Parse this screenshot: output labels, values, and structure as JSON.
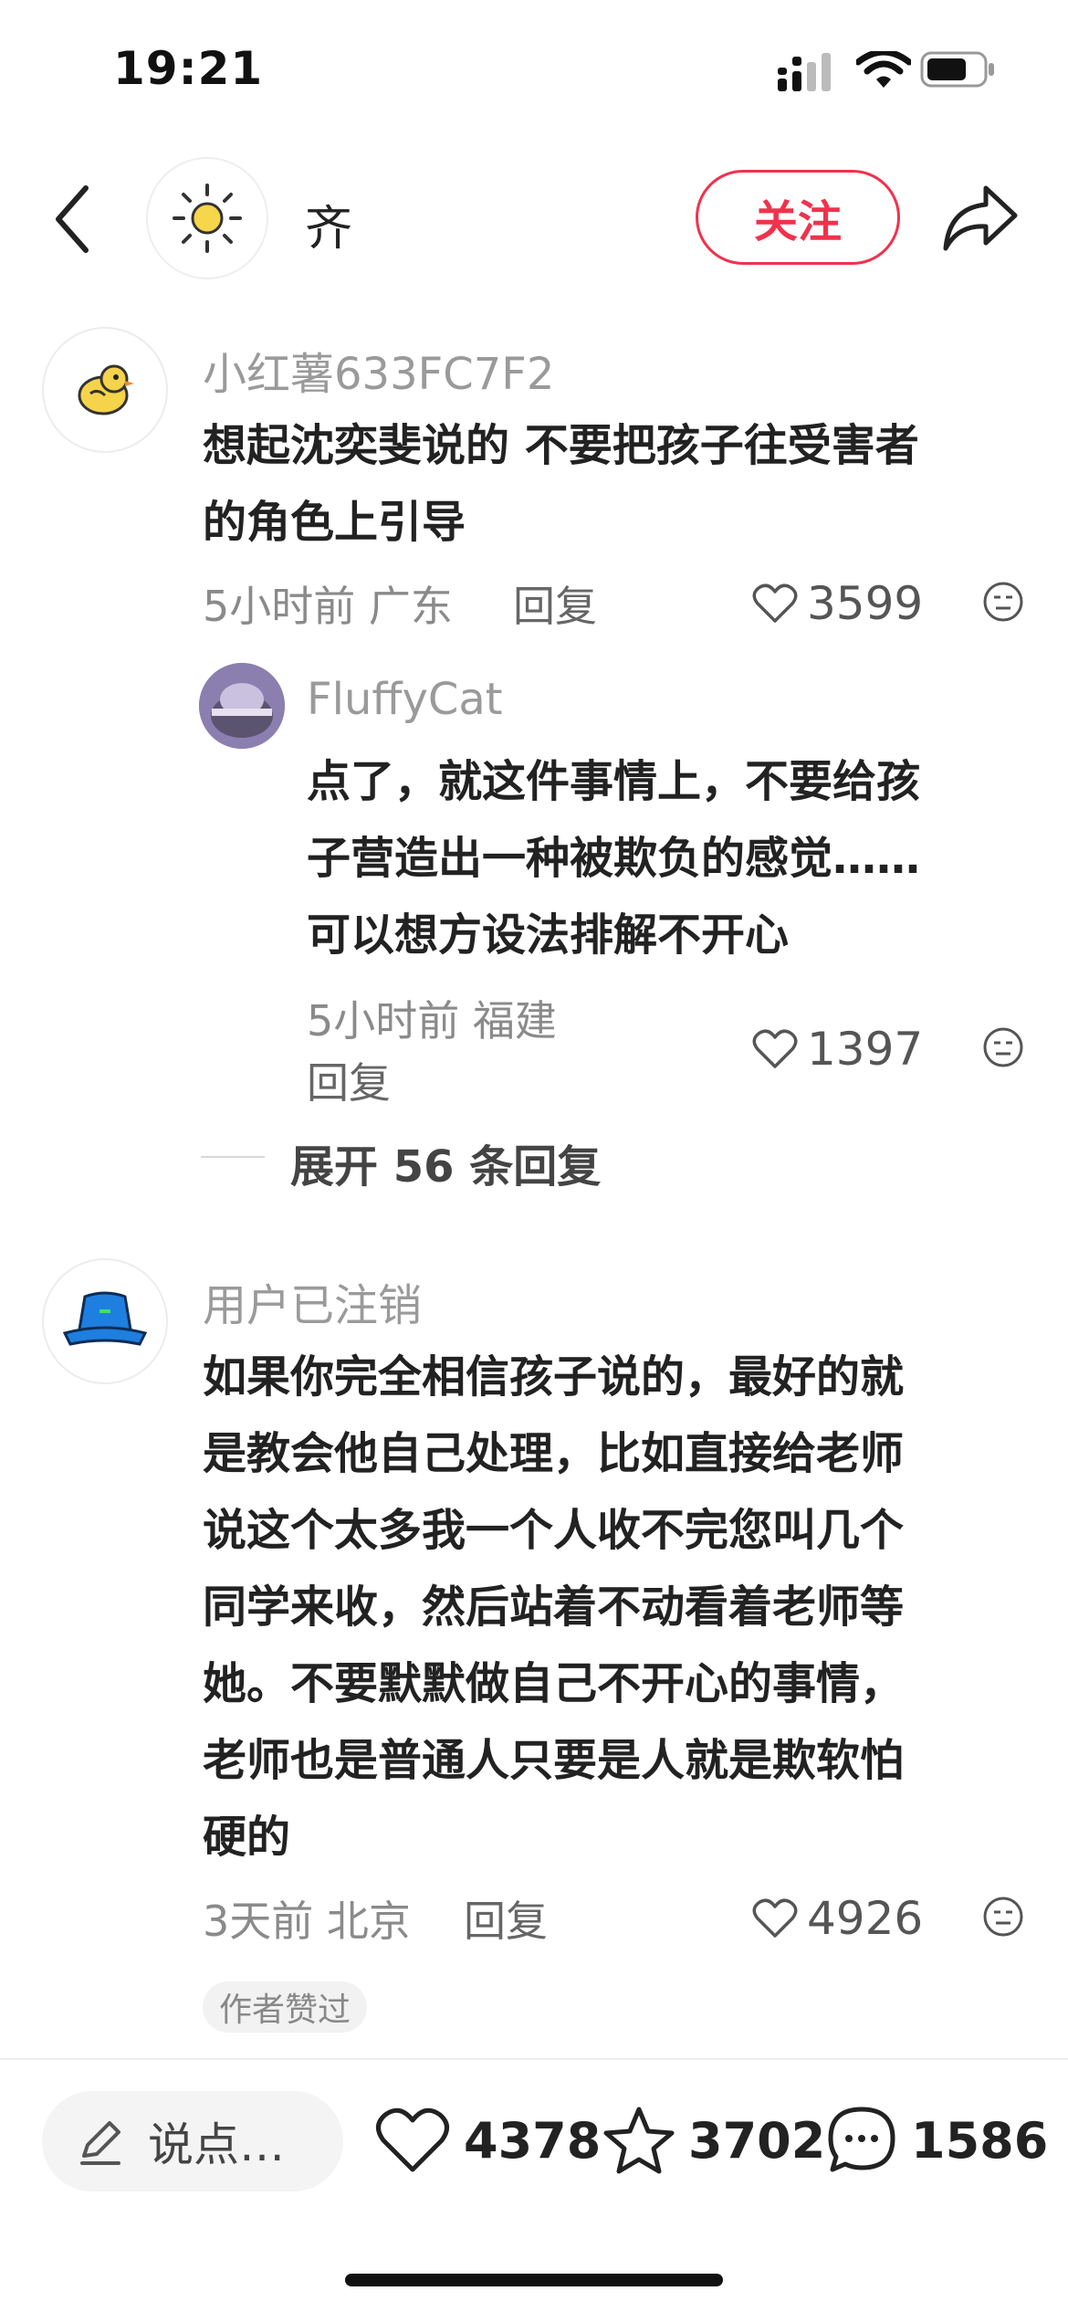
{
  "status_bar": {
    "time": "19:21"
  },
  "header": {
    "name": "齐",
    "follow_label": "关注"
  },
  "comments": [
    {
      "user": "小红薯633FC7F2",
      "lines": [
        "想起沈奕斐说的 不要把孩子往受害者",
        "的角色上引导"
      ],
      "meta": "5小时前 广东",
      "reply_label": "回复",
      "likes": "3599"
    },
    {
      "user": "FluffyCat",
      "lines": [
        "点了，就这件事情上，不要给孩",
        "子营造出一种被欺负的感觉……",
        "可以想方设法排解不开心"
      ],
      "meta": "5小时前 福建",
      "reply_label": "回复",
      "likes": "1397"
    },
    {
      "user": "用户已注销",
      "lines": [
        "如果你完全相信孩子说的，最好的就",
        "是教会他自己处理，比如直接给老师",
        "说这个太多我一个人收不完您叫几个",
        "同学来收，然后站着不动看着老师等",
        "她。不要默默做自己不开心的事情，",
        "老师也是普通人只要是人就是欺软怕",
        "硬的"
      ],
      "meta": "3天前 北京",
      "reply_label": "回复",
      "likes": "4926",
      "tag": "作者赞过"
    }
  ],
  "expand_replies": "展开 56 条回复",
  "bottom_bar": {
    "input_placeholder": "说点…",
    "likes": "4378",
    "stars": "3702",
    "comments": "1586"
  },
  "colors": {
    "accent": "#f0324c"
  }
}
